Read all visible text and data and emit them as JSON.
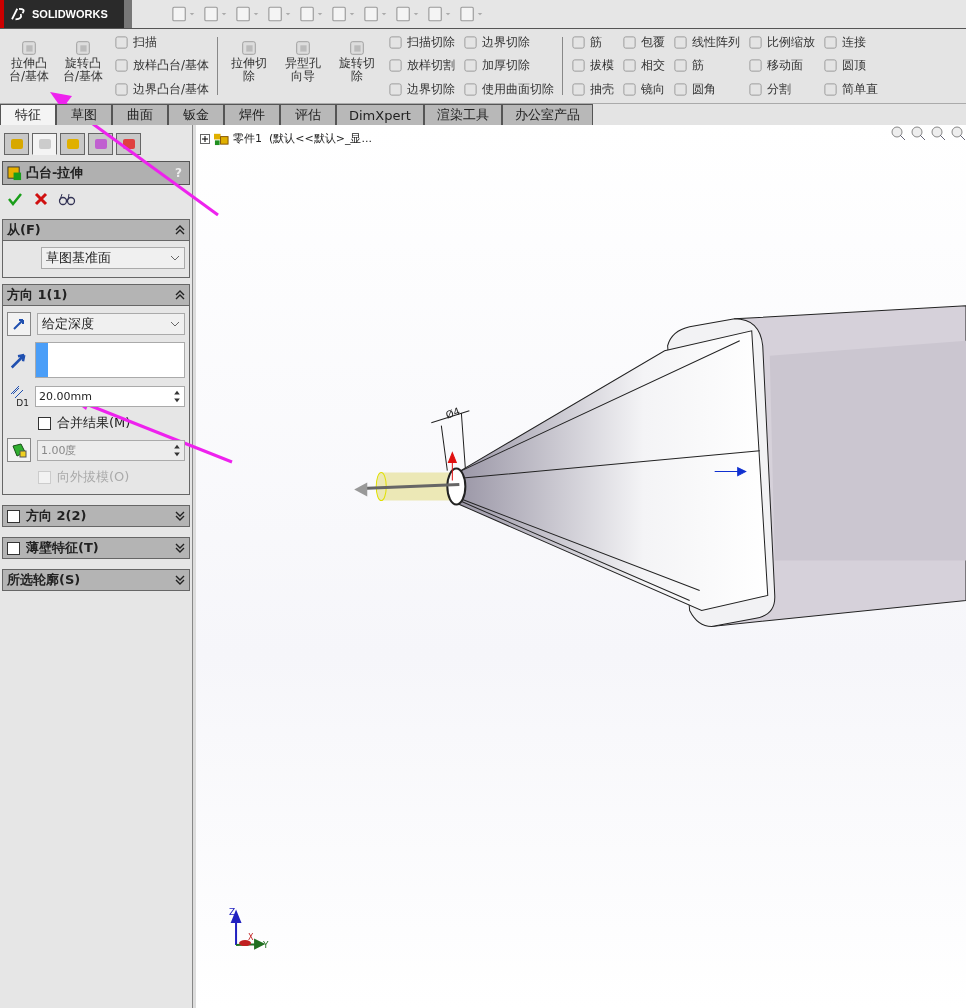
{
  "app": {
    "logo": "SOLIDWORKS"
  },
  "ribbon": {
    "groups": [
      {
        "large": [
          "拉伸凸台/基体",
          "旋转凸台/基体"
        ],
        "columns": [
          [
            "扫描",
            "放样凸台/基体",
            "边界凸台/基体"
          ]
        ]
      },
      {
        "large": [
          "拉伸切除",
          "异型孔向导",
          "旋转切除"
        ],
        "columns": [
          [
            "扫描切除",
            "放样切割",
            "边界切除"
          ],
          [
            "边界切除",
            "加厚切除",
            "使用曲面切除"
          ]
        ]
      },
      {
        "columns": [
          [
            "筋",
            "拔模",
            "抽壳"
          ],
          [
            "包覆",
            "相交",
            "镜向"
          ],
          [
            "线性阵列",
            "筋",
            "圆角"
          ],
          [
            "比例缩放",
            "移动面",
            "分割"
          ],
          [
            "连接",
            "圆顶",
            "简单直"
          ]
        ]
      }
    ]
  },
  "tabs": [
    {
      "label": "特征",
      "selected": true
    },
    {
      "label": "草图",
      "selected": false
    },
    {
      "label": "曲面",
      "selected": false
    },
    {
      "label": "钣金",
      "selected": false
    },
    {
      "label": "焊件",
      "selected": false
    },
    {
      "label": "评估",
      "selected": false
    },
    {
      "label": "DimXpert",
      "selected": false
    },
    {
      "label": "渲染工具",
      "selected": false
    },
    {
      "label": "办公室产品",
      "selected": false
    }
  ],
  "panel": {
    "icon_tabs": [
      {
        "selected": false
      },
      {
        "selected": true
      },
      {
        "selected": false
      },
      {
        "selected": false
      },
      {
        "selected": false
      }
    ],
    "title": "凸台-拉伸",
    "help": "?",
    "from": {
      "header": "从(F)",
      "value": "草图基准面"
    },
    "direction1": {
      "header": "方向 1(1)",
      "end_condition": "给定深度",
      "depth": "20.00mm",
      "depth_icon_label": "D1",
      "merge": {
        "label": "合并结果(M)",
        "checked": false
      },
      "draft_angle": "1.00度",
      "draft_outward": {
        "label": "向外拔模(O)",
        "checked": false,
        "disabled": true
      }
    },
    "collapsed": [
      {
        "label": "方向 2(2)",
        "kind": "checkbox",
        "checked": false
      },
      {
        "label": "薄壁特征(T)",
        "kind": "checkbox",
        "checked": false
      },
      {
        "label": "所选轮廓(S)",
        "kind": "plain"
      }
    ]
  },
  "viewport": {
    "tree_root": "零件1  (默认<<默认>_显...",
    "dimension": "Ø4",
    "triad": {
      "z": "Z",
      "x": "X",
      "y": "Y"
    }
  }
}
